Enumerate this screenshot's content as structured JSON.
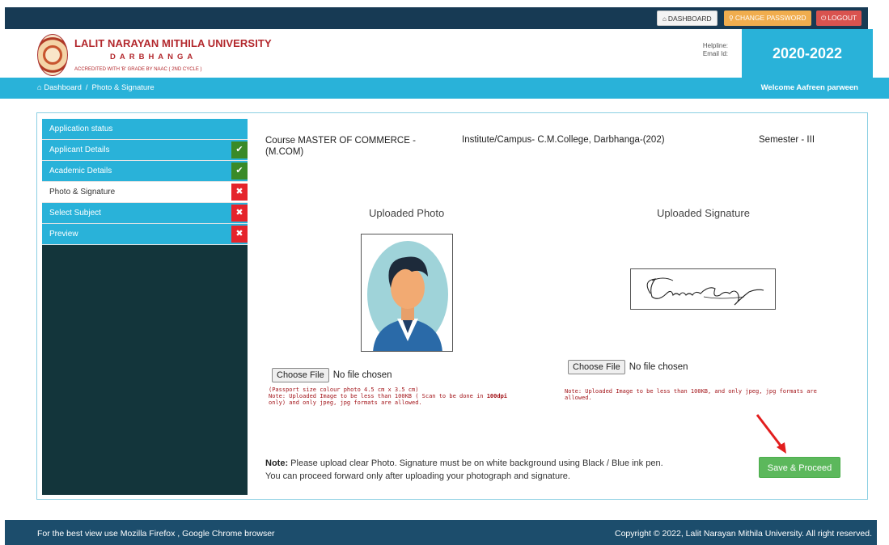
{
  "topbar": {
    "dashboard_label": "DASHBOARD",
    "change_password_label": "CHANGE PASSWORD",
    "logout_label": "LOGOUT"
  },
  "header": {
    "university_name": "LALIT NARAYAN MITHILA UNIVERSITY",
    "city": "DARBHANGA",
    "accreditation": "ACCREDITED WITH 'B' GRADE BY NAAC ( 2ND CYCLE )",
    "helpline_label": "Helpline:",
    "email_label": "Email Id:",
    "session": "2020-2022"
  },
  "breadcrumb": {
    "home": "Dashboard",
    "separator": "/",
    "current": "Photo & Signature",
    "welcome": "Welcome Aafreen parween"
  },
  "sidebar": {
    "items": [
      {
        "label": "Application status",
        "status": ""
      },
      {
        "label": "Applicant Details",
        "status": "ok"
      },
      {
        "label": "Academic Details",
        "status": "ok"
      },
      {
        "label": "Photo & Signature",
        "status": "bad"
      },
      {
        "label": "Select Subject",
        "status": "bad"
      },
      {
        "label": "Preview",
        "status": "bad"
      }
    ],
    "ok_symbol": "✔",
    "bad_symbol": "✖"
  },
  "main": {
    "course": "Course MASTER OF COMMERCE - (M.COM)",
    "institute": "Institute/Campus- C.M.College, Darbhanga-(202)",
    "semester": "Semester - III",
    "photo_title": "Uploaded Photo",
    "signature_title": "Uploaded Signature",
    "choose_file_label": "Choose File",
    "no_file_text": "No file chosen",
    "photo_hint_line1": "(Passport size colour photo 4.5 cm x 3.5 cm)",
    "photo_hint_line2_a": "Note: Uploaded Image to be less than 100KB ( Scan to be done in ",
    "photo_hint_dpi": "100dpi",
    "photo_hint_line2_b": " only) and only jpeg, jpg formats are allowed.",
    "signature_hint": "Note: Uploaded Image to be less than 100KB, and only jpeg, jpg formats are allowed.",
    "note_label": "Note:",
    "note_text": " Please upload clear Photo. Signature must be on white background using Black / Blue ink pen.",
    "note_text2": "You can proceed forward only after uploading your photograph and signature.",
    "save_label": "Save & Proceed"
  },
  "footer": {
    "left": "For the best view use Mozilla Firefox , Google Chrome browser",
    "right": "Copyright © 2022, Lalit Narayan Mithila University. All right reserved."
  },
  "colors": {
    "accent": "#29b2d9",
    "topbar": "#173a54",
    "sidebar_bg": "#13353b",
    "ok": "#3a8a28",
    "bad": "#e5242b",
    "save": "#5cb85c"
  },
  "icons": [
    "home-icon",
    "key-icon",
    "power-icon",
    "check-icon",
    "cross-icon",
    "arrow-annotation-icon"
  ]
}
